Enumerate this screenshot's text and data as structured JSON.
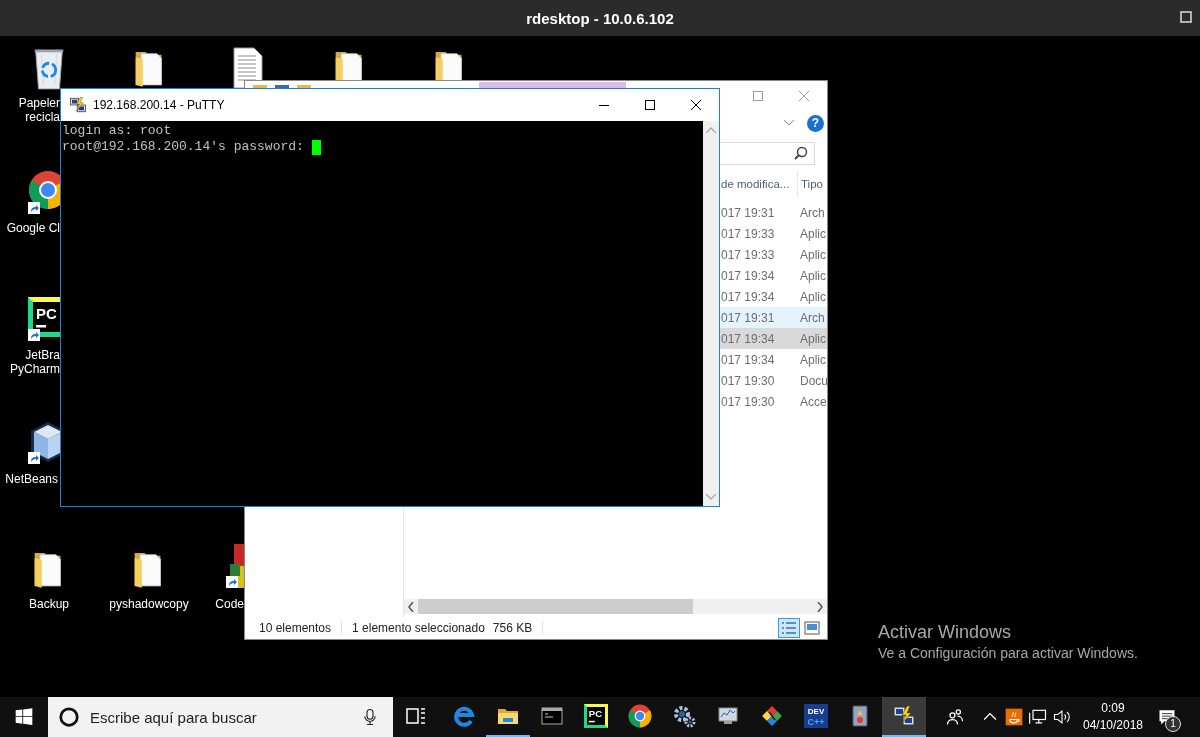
{
  "remote_window": {
    "title": "rdesktop - 10.0.6.102"
  },
  "desktop_icons": [
    {
      "kind": "recycle-bin",
      "label_lines": [
        "Papeler",
        "recicla"
      ],
      "shortcut": false
    },
    {
      "kind": "folder",
      "shortcut": false
    },
    {
      "kind": "document",
      "shortcut": false
    },
    {
      "kind": "folder",
      "shortcut": false
    },
    {
      "kind": "folder",
      "shortcut": false
    },
    {
      "kind": "chrome",
      "label_lines": [
        "Google Cl"
      ],
      "shortcut": true
    },
    {
      "kind": "pycharm",
      "icon_text": "PC",
      "label_lines": [
        "JetBra",
        "PyCharm"
      ],
      "shortcut": true
    },
    {
      "kind": "netbeans",
      "label_lines": [
        "NetBeans"
      ],
      "shortcut": true
    },
    {
      "kind": "folder",
      "label_lines": [
        "Backup"
      ],
      "shortcut": false
    },
    {
      "kind": "folder",
      "label_lines": [
        "pyshadowcopy"
      ],
      "shortcut": false
    },
    {
      "kind": "code",
      "label_lines": [
        "Code"
      ],
      "shortcut": true
    }
  ],
  "explorer": {
    "help_label": "?",
    "columns": [
      "de modifica...",
      "Tipo"
    ],
    "rows": [
      {
        "modified": "017 19:31",
        "type": "Arch",
        "selected": false,
        "highlighted": false
      },
      {
        "modified": "017 19:33",
        "type": "Aplic",
        "selected": false,
        "highlighted": false
      },
      {
        "modified": "017 19:33",
        "type": "Aplic",
        "selected": false,
        "highlighted": false
      },
      {
        "modified": "017 19:34",
        "type": "Aplic",
        "selected": false,
        "highlighted": false
      },
      {
        "modified": "017 19:34",
        "type": "Aplic",
        "selected": false,
        "highlighted": false
      },
      {
        "modified": "017 19:31",
        "type": "Arch",
        "selected": false,
        "highlighted": true
      },
      {
        "modified": "017 19:34",
        "type": "Aplic",
        "selected": true,
        "highlighted": false
      },
      {
        "modified": "017 19:34",
        "type": "Aplic",
        "selected": false,
        "highlighted": false
      },
      {
        "modified": "017 19:30",
        "type": "Docu",
        "selected": false,
        "highlighted": false
      },
      {
        "modified": "017 19:30",
        "type": "Acce",
        "selected": false,
        "highlighted": false
      }
    ],
    "status": {
      "count": "10 elementos",
      "selection": "1 elemento seleccionado",
      "size": "756 KB"
    },
    "view_buttons": [
      {
        "kind": "details",
        "selected": true
      },
      {
        "kind": "large-icons",
        "selected": false
      }
    ]
  },
  "putty": {
    "title": "192.168.200.14 - PuTTY",
    "terminal_lines": [
      "login as: root",
      "root@192.168.200.14's password:"
    ],
    "cursor_visible": true
  },
  "activation_notice": {
    "title": "Activar Windows",
    "message": "Ve a Configuración para activar Windows."
  },
  "taskbar": {
    "search": {
      "placeholder": "Escribe aquí para buscar"
    },
    "apps": [
      {
        "kind": "task-view",
        "running": false,
        "active": false
      },
      {
        "kind": "edge",
        "running": false,
        "active": false
      },
      {
        "kind": "explorer",
        "running": true,
        "active": false
      },
      {
        "kind": "cmd",
        "running": false,
        "active": false
      },
      {
        "kind": "pycharm",
        "icon_text": "PC",
        "running": false,
        "active": false
      },
      {
        "kind": "chrome",
        "running": false,
        "active": false
      },
      {
        "kind": "gears",
        "running": false,
        "active": false
      },
      {
        "kind": "monitor",
        "running": false,
        "active": false
      },
      {
        "kind": "git",
        "running": false,
        "active": false
      },
      {
        "kind": "devcpp",
        "text_lines": [
          "DEV",
          "C++"
        ],
        "running": false,
        "active": false
      },
      {
        "kind": "book",
        "running": false,
        "active": false
      },
      {
        "kind": "putty",
        "running": true,
        "active": true
      }
    ],
    "clock": {
      "time": "0:09",
      "date": "04/10/2018"
    },
    "notifications": {
      "count": "1"
    }
  }
}
